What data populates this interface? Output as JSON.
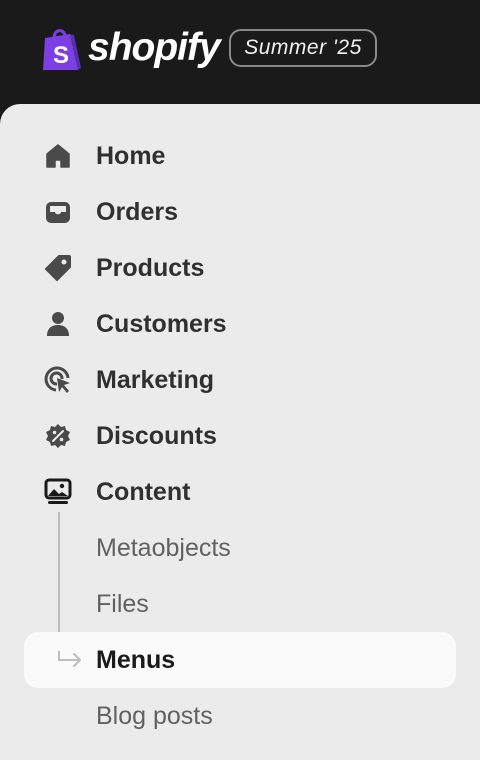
{
  "header": {
    "logo_text": "shopify",
    "edition_badge": "Summer '25",
    "colors": {
      "topbar": "#1a1a1a",
      "logo_bag": "#7b3fe4"
    }
  },
  "sidebar": {
    "items": [
      {
        "label": "Home",
        "icon": "home-icon"
      },
      {
        "label": "Orders",
        "icon": "inbox-icon"
      },
      {
        "label": "Products",
        "icon": "tag-icon"
      },
      {
        "label": "Customers",
        "icon": "person-icon"
      },
      {
        "label": "Marketing",
        "icon": "target-cursor-icon"
      },
      {
        "label": "Discounts",
        "icon": "discount-badge-icon"
      },
      {
        "label": "Content",
        "icon": "image-frame-icon",
        "expanded": true
      }
    ],
    "content_subitems": [
      {
        "label": "Metaobjects",
        "selected": false
      },
      {
        "label": "Files",
        "selected": false
      },
      {
        "label": "Menus",
        "selected": true
      },
      {
        "label": "Blog posts",
        "selected": false
      }
    ],
    "colors": {
      "panel_bg": "#ebebeb",
      "selected_bg": "#fafafa",
      "text_primary": "#303030",
      "text_secondary": "#616161"
    }
  }
}
